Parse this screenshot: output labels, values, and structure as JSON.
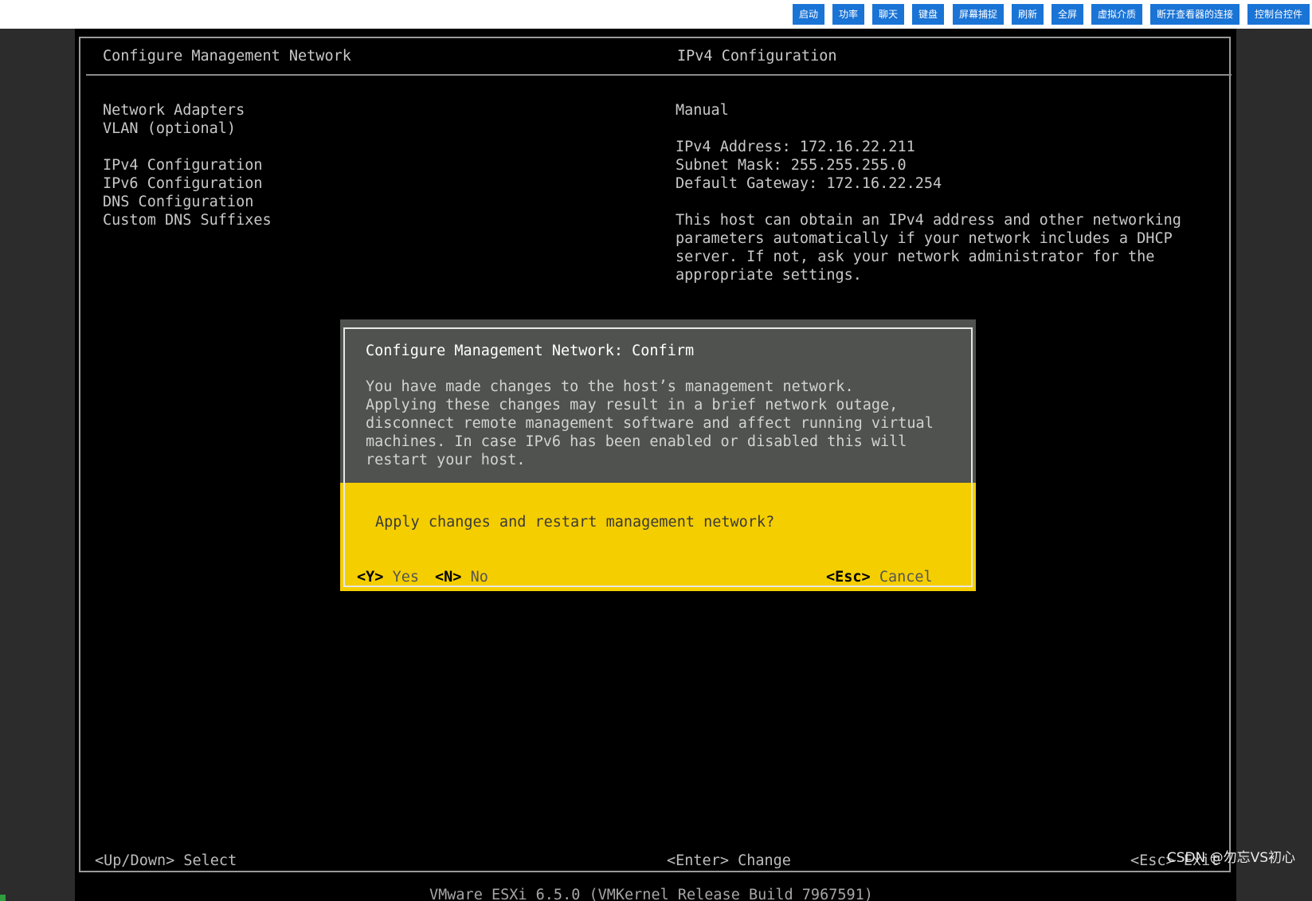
{
  "toolbar": {
    "buttons": [
      "启动",
      "功率",
      "聊天",
      "键盘",
      "屏幕捕捉",
      "刷新",
      "全屏",
      "虚拟介质",
      "断开查看器的连接",
      "控制台控件"
    ],
    "accent_color": "#1a74d6"
  },
  "screen": {
    "title": "Configure Management Network",
    "right_title": "IPv4 Configuration",
    "menu": [
      "Network Adapters",
      "VLAN (optional)",
      "IPv4 Configuration",
      "IPv6 Configuration",
      "DNS Configuration",
      "Custom DNS Suffixes"
    ],
    "info": {
      "mode": "Manual",
      "address": "IPv4 Address: 172.16.22.211",
      "subnet": "Subnet Mask: 255.255.255.0",
      "gateway": "Default Gateway: 172.16.22.254",
      "description": [
        "This host can obtain an IPv4 address and other networking",
        "parameters automatically if your network includes a DHCP",
        "server. If not, ask your network administrator for the",
        "appropriate settings."
      ]
    },
    "footer": {
      "select": "<Up/Down> Select",
      "change": "<Enter> Change",
      "exit": "<Esc> Exit"
    },
    "version": "VMware ESXi 6.5.0 (VMKernel Release Build 7967591)"
  },
  "dialog": {
    "title": "Configure Management Network: Confirm",
    "body": [
      "You have made changes to the host’s management network.",
      "Applying these changes may result in a brief network outage,",
      "disconnect remote management software and affect running virtual",
      "machines. In case IPv6 has been enabled or disabled this will",
      "restart your host."
    ],
    "question": "Apply changes and restart management network?",
    "yes_key": "<Y>",
    "yes_label": "Yes",
    "no_key": "<N>",
    "no_label": "No",
    "cancel_key": "<Esc>",
    "cancel_label": "Cancel",
    "accent_color": "#f5ce00",
    "panel_color": "#4f524f"
  },
  "watermark": "CSDN @勿忘VS初心"
}
